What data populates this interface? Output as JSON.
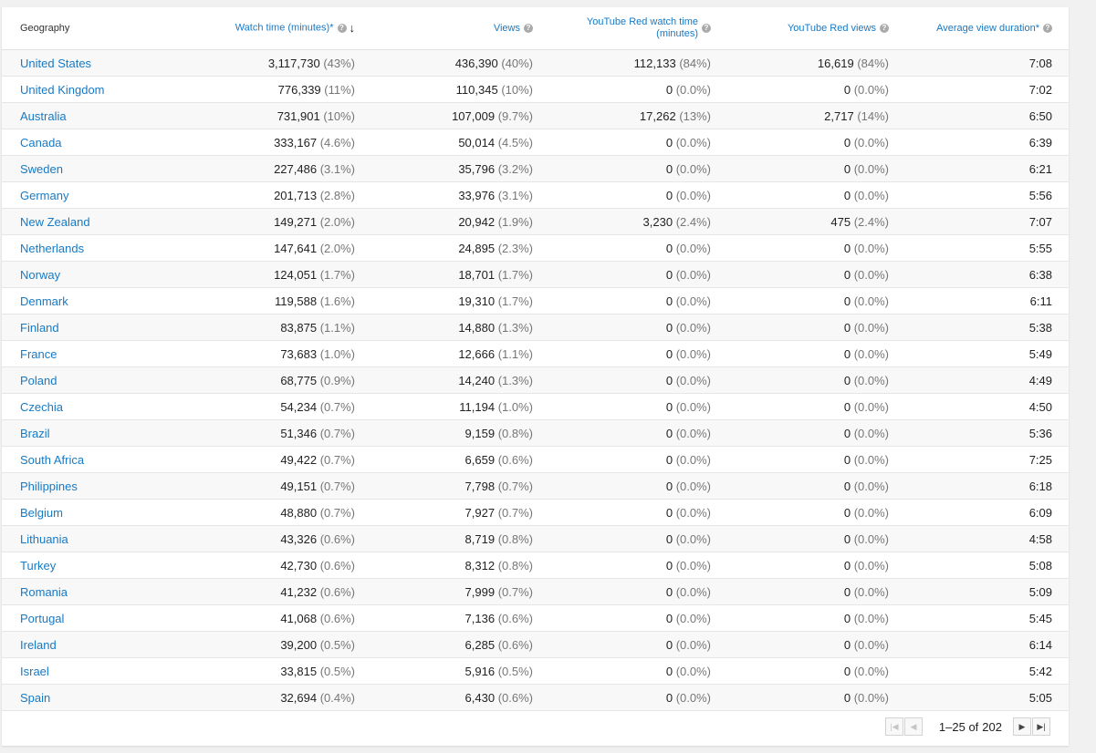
{
  "table": {
    "headers": {
      "geography": "Geography",
      "watch_time": "Watch time (minutes)*",
      "views": "Views",
      "red_watch_time_line1": "YouTube Red watch time",
      "red_watch_time_line2": "(minutes)",
      "red_views": "YouTube Red views",
      "avg_duration": "Average view duration*"
    },
    "rows": [
      {
        "country": "United States",
        "watch": "3,117,730",
        "watch_pct": "(43%)",
        "views": "436,390",
        "views_pct": "(40%)",
        "red_watch": "112,133",
        "red_watch_pct": "(84%)",
        "red_views": "16,619",
        "red_views_pct": "(84%)",
        "avg": "7:08"
      },
      {
        "country": "United Kingdom",
        "watch": "776,339",
        "watch_pct": "(11%)",
        "views": "110,345",
        "views_pct": "(10%)",
        "red_watch": "0",
        "red_watch_pct": "(0.0%)",
        "red_views": "0",
        "red_views_pct": "(0.0%)",
        "avg": "7:02"
      },
      {
        "country": "Australia",
        "watch": "731,901",
        "watch_pct": "(10%)",
        "views": "107,009",
        "views_pct": "(9.7%)",
        "red_watch": "17,262",
        "red_watch_pct": "(13%)",
        "red_views": "2,717",
        "red_views_pct": "(14%)",
        "avg": "6:50"
      },
      {
        "country": "Canada",
        "watch": "333,167",
        "watch_pct": "(4.6%)",
        "views": "50,014",
        "views_pct": "(4.5%)",
        "red_watch": "0",
        "red_watch_pct": "(0.0%)",
        "red_views": "0",
        "red_views_pct": "(0.0%)",
        "avg": "6:39"
      },
      {
        "country": "Sweden",
        "watch": "227,486",
        "watch_pct": "(3.1%)",
        "views": "35,796",
        "views_pct": "(3.2%)",
        "red_watch": "0",
        "red_watch_pct": "(0.0%)",
        "red_views": "0",
        "red_views_pct": "(0.0%)",
        "avg": "6:21"
      },
      {
        "country": "Germany",
        "watch": "201,713",
        "watch_pct": "(2.8%)",
        "views": "33,976",
        "views_pct": "(3.1%)",
        "red_watch": "0",
        "red_watch_pct": "(0.0%)",
        "red_views": "0",
        "red_views_pct": "(0.0%)",
        "avg": "5:56"
      },
      {
        "country": "New Zealand",
        "watch": "149,271",
        "watch_pct": "(2.0%)",
        "views": "20,942",
        "views_pct": "(1.9%)",
        "red_watch": "3,230",
        "red_watch_pct": "(2.4%)",
        "red_views": "475",
        "red_views_pct": "(2.4%)",
        "avg": "7:07"
      },
      {
        "country": "Netherlands",
        "watch": "147,641",
        "watch_pct": "(2.0%)",
        "views": "24,895",
        "views_pct": "(2.3%)",
        "red_watch": "0",
        "red_watch_pct": "(0.0%)",
        "red_views": "0",
        "red_views_pct": "(0.0%)",
        "avg": "5:55"
      },
      {
        "country": "Norway",
        "watch": "124,051",
        "watch_pct": "(1.7%)",
        "views": "18,701",
        "views_pct": "(1.7%)",
        "red_watch": "0",
        "red_watch_pct": "(0.0%)",
        "red_views": "0",
        "red_views_pct": "(0.0%)",
        "avg": "6:38"
      },
      {
        "country": "Denmark",
        "watch": "119,588",
        "watch_pct": "(1.6%)",
        "views": "19,310",
        "views_pct": "(1.7%)",
        "red_watch": "0",
        "red_watch_pct": "(0.0%)",
        "red_views": "0",
        "red_views_pct": "(0.0%)",
        "avg": "6:11"
      },
      {
        "country": "Finland",
        "watch": "83,875",
        "watch_pct": "(1.1%)",
        "views": "14,880",
        "views_pct": "(1.3%)",
        "red_watch": "0",
        "red_watch_pct": "(0.0%)",
        "red_views": "0",
        "red_views_pct": "(0.0%)",
        "avg": "5:38"
      },
      {
        "country": "France",
        "watch": "73,683",
        "watch_pct": "(1.0%)",
        "views": "12,666",
        "views_pct": "(1.1%)",
        "red_watch": "0",
        "red_watch_pct": "(0.0%)",
        "red_views": "0",
        "red_views_pct": "(0.0%)",
        "avg": "5:49"
      },
      {
        "country": "Poland",
        "watch": "68,775",
        "watch_pct": "(0.9%)",
        "views": "14,240",
        "views_pct": "(1.3%)",
        "red_watch": "0",
        "red_watch_pct": "(0.0%)",
        "red_views": "0",
        "red_views_pct": "(0.0%)",
        "avg": "4:49"
      },
      {
        "country": "Czechia",
        "watch": "54,234",
        "watch_pct": "(0.7%)",
        "views": "11,194",
        "views_pct": "(1.0%)",
        "red_watch": "0",
        "red_watch_pct": "(0.0%)",
        "red_views": "0",
        "red_views_pct": "(0.0%)",
        "avg": "4:50"
      },
      {
        "country": "Brazil",
        "watch": "51,346",
        "watch_pct": "(0.7%)",
        "views": "9,159",
        "views_pct": "(0.8%)",
        "red_watch": "0",
        "red_watch_pct": "(0.0%)",
        "red_views": "0",
        "red_views_pct": "(0.0%)",
        "avg": "5:36"
      },
      {
        "country": "South Africa",
        "watch": "49,422",
        "watch_pct": "(0.7%)",
        "views": "6,659",
        "views_pct": "(0.6%)",
        "red_watch": "0",
        "red_watch_pct": "(0.0%)",
        "red_views": "0",
        "red_views_pct": "(0.0%)",
        "avg": "7:25"
      },
      {
        "country": "Philippines",
        "watch": "49,151",
        "watch_pct": "(0.7%)",
        "views": "7,798",
        "views_pct": "(0.7%)",
        "red_watch": "0",
        "red_watch_pct": "(0.0%)",
        "red_views": "0",
        "red_views_pct": "(0.0%)",
        "avg": "6:18"
      },
      {
        "country": "Belgium",
        "watch": "48,880",
        "watch_pct": "(0.7%)",
        "views": "7,927",
        "views_pct": "(0.7%)",
        "red_watch": "0",
        "red_watch_pct": "(0.0%)",
        "red_views": "0",
        "red_views_pct": "(0.0%)",
        "avg": "6:09"
      },
      {
        "country": "Lithuania",
        "watch": "43,326",
        "watch_pct": "(0.6%)",
        "views": "8,719",
        "views_pct": "(0.8%)",
        "red_watch": "0",
        "red_watch_pct": "(0.0%)",
        "red_views": "0",
        "red_views_pct": "(0.0%)",
        "avg": "4:58"
      },
      {
        "country": "Turkey",
        "watch": "42,730",
        "watch_pct": "(0.6%)",
        "views": "8,312",
        "views_pct": "(0.8%)",
        "red_watch": "0",
        "red_watch_pct": "(0.0%)",
        "red_views": "0",
        "red_views_pct": "(0.0%)",
        "avg": "5:08"
      },
      {
        "country": "Romania",
        "watch": "41,232",
        "watch_pct": "(0.6%)",
        "views": "7,999",
        "views_pct": "(0.7%)",
        "red_watch": "0",
        "red_watch_pct": "(0.0%)",
        "red_views": "0",
        "red_views_pct": "(0.0%)",
        "avg": "5:09"
      },
      {
        "country": "Portugal",
        "watch": "41,068",
        "watch_pct": "(0.6%)",
        "views": "7,136",
        "views_pct": "(0.6%)",
        "red_watch": "0",
        "red_watch_pct": "(0.0%)",
        "red_views": "0",
        "red_views_pct": "(0.0%)",
        "avg": "5:45"
      },
      {
        "country": "Ireland",
        "watch": "39,200",
        "watch_pct": "(0.5%)",
        "views": "6,285",
        "views_pct": "(0.6%)",
        "red_watch": "0",
        "red_watch_pct": "(0.0%)",
        "red_views": "0",
        "red_views_pct": "(0.0%)",
        "avg": "6:14"
      },
      {
        "country": "Israel",
        "watch": "33,815",
        "watch_pct": "(0.5%)",
        "views": "5,916",
        "views_pct": "(0.5%)",
        "red_watch": "0",
        "red_watch_pct": "(0.0%)",
        "red_views": "0",
        "red_views_pct": "(0.0%)",
        "avg": "5:42"
      },
      {
        "country": "Spain",
        "watch": "32,694",
        "watch_pct": "(0.4%)",
        "views": "6,430",
        "views_pct": "(0.6%)",
        "red_watch": "0",
        "red_watch_pct": "(0.0%)",
        "red_views": "0",
        "red_views_pct": "(0.0%)",
        "avg": "5:05"
      }
    ]
  },
  "pagination": {
    "range": "1–25 of",
    "total": "202"
  },
  "icons": {
    "help": "help-circle-icon",
    "sort": "arrow-down-icon",
    "first": "first-page-icon",
    "prev": "prev-page-icon",
    "next": "next-page-icon",
    "last": "last-page-icon"
  },
  "colors": {
    "link": "#167ac6",
    "percent": "#767676",
    "stripe": "#f8f8f8"
  }
}
